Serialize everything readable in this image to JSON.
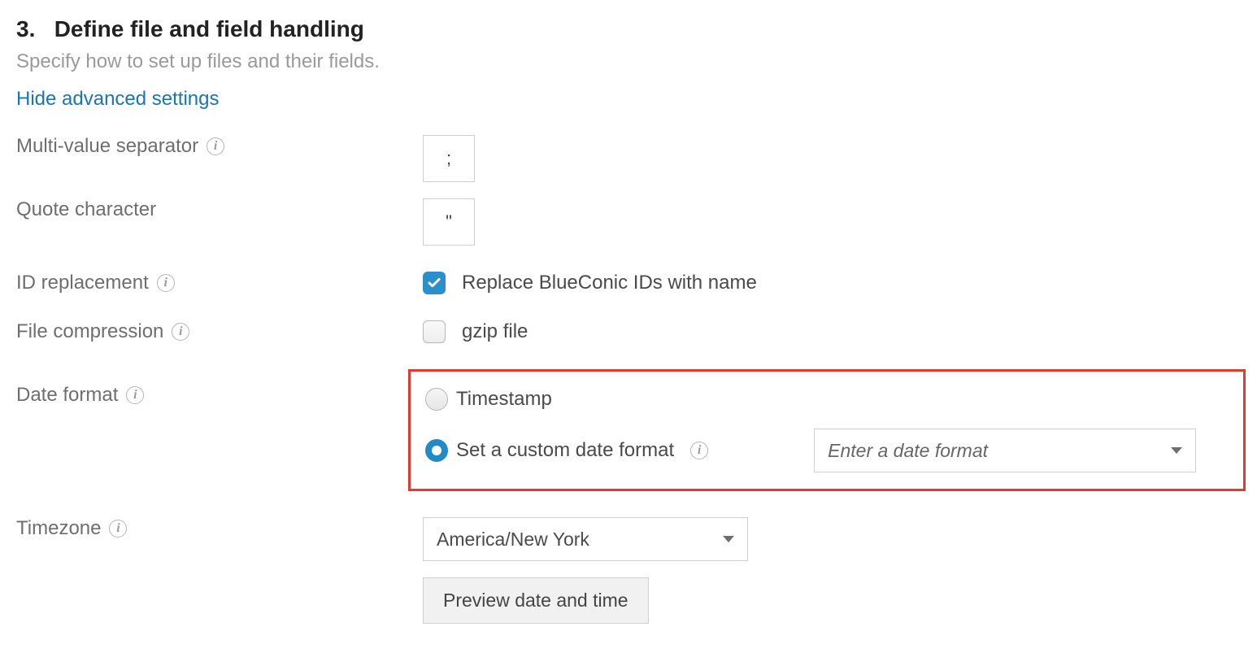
{
  "section": {
    "number": "3.",
    "title": "Define file and field handling",
    "subtitle": "Specify how to set up files and their fields.",
    "toggle_link": "Hide advanced settings"
  },
  "labels": {
    "multi_value_separator": "Multi-value separator",
    "quote_character": "Quote character",
    "id_replacement": "ID replacement",
    "file_compression": "File compression",
    "date_format": "Date format",
    "timezone": "Timezone"
  },
  "values": {
    "multi_value_separator": ";",
    "quote_character": "\"",
    "id_replacement_label": "Replace BlueConic IDs with name",
    "id_replacement_checked": true,
    "file_compression_label": "gzip file",
    "file_compression_checked": false,
    "date_format_options": {
      "timestamp_label": "Timestamp",
      "custom_label": "Set a custom date format",
      "selected": "custom",
      "custom_placeholder": "Enter a date format",
      "custom_value": ""
    },
    "timezone_selected": "America/New York",
    "preview_button": "Preview date and time"
  },
  "icons": {
    "info_glyph": "i"
  }
}
